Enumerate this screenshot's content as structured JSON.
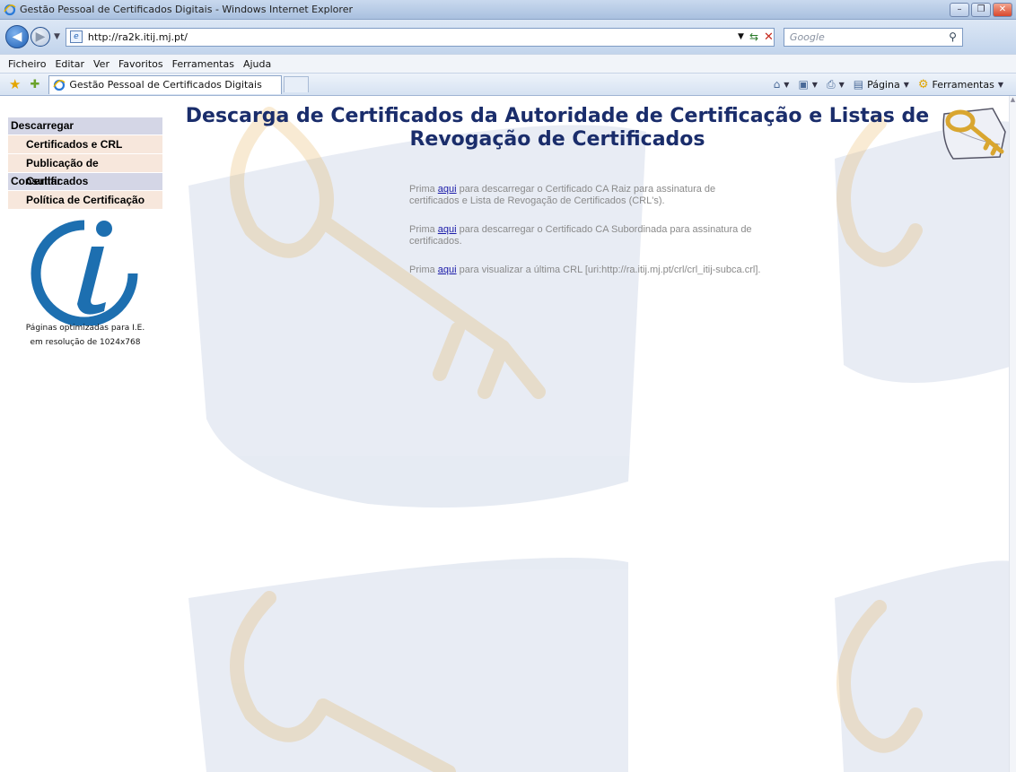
{
  "window": {
    "title": "Gestão Pessoal de Certificados Digitais - Windows Internet Explorer"
  },
  "address": {
    "url": "http://ra2k.itij.mj.pt/",
    "search_placeholder": "Google"
  },
  "menu": {
    "items": [
      "Ficheiro",
      "Editar",
      "Ver",
      "Favoritos",
      "Ferramentas",
      "Ajuda"
    ]
  },
  "tabs": {
    "active_label": "Gestão Pessoal de Certificados Digitais",
    "page_label": "Página",
    "tools_label": "Ferramentas"
  },
  "page": {
    "heading_line1": "Descarga de Certificados da Autoridade de Certificação e Listas de",
    "heading_line2": "Revogação de Certificados",
    "sidebar": {
      "section1": "Descarregar",
      "items1": [
        "Certificados e CRL",
        "Publicação de Certificados"
      ],
      "section2": "Consultar",
      "items2": [
        "Política de Certificação"
      ]
    },
    "optimized_line1": "Páginas optimizadas para I.E.",
    "optimized_line2": "em resolução de 1024x768",
    "paragraphs": [
      {
        "prefix": "Prima ",
        "link": "aqui",
        "suffix": " para descarregar o Certificado CA Raiz para assinatura de certificados e Lista de Revogação de Certificados (CRL's)."
      },
      {
        "prefix": "Prima ",
        "link": "aqui",
        "suffix": " para descarregar o Certificado CA Subordinada para assinatura de certificados."
      },
      {
        "prefix": "Prima ",
        "link": "aqui",
        "suffix": " para visualizar a última CRL [uri:http://ra.itij.mj.pt/crl/crl_itij-subca.crl]."
      }
    ]
  },
  "colors": {
    "heading": "#1a2d6b",
    "sidebar_header_bg": "#d4d6e6",
    "sidebar_item_bg": "#f7e7dc",
    "paragraph_text": "#8a8a8a",
    "link": "#1a1aa8",
    "logo_blue": "#1d6fb0"
  }
}
